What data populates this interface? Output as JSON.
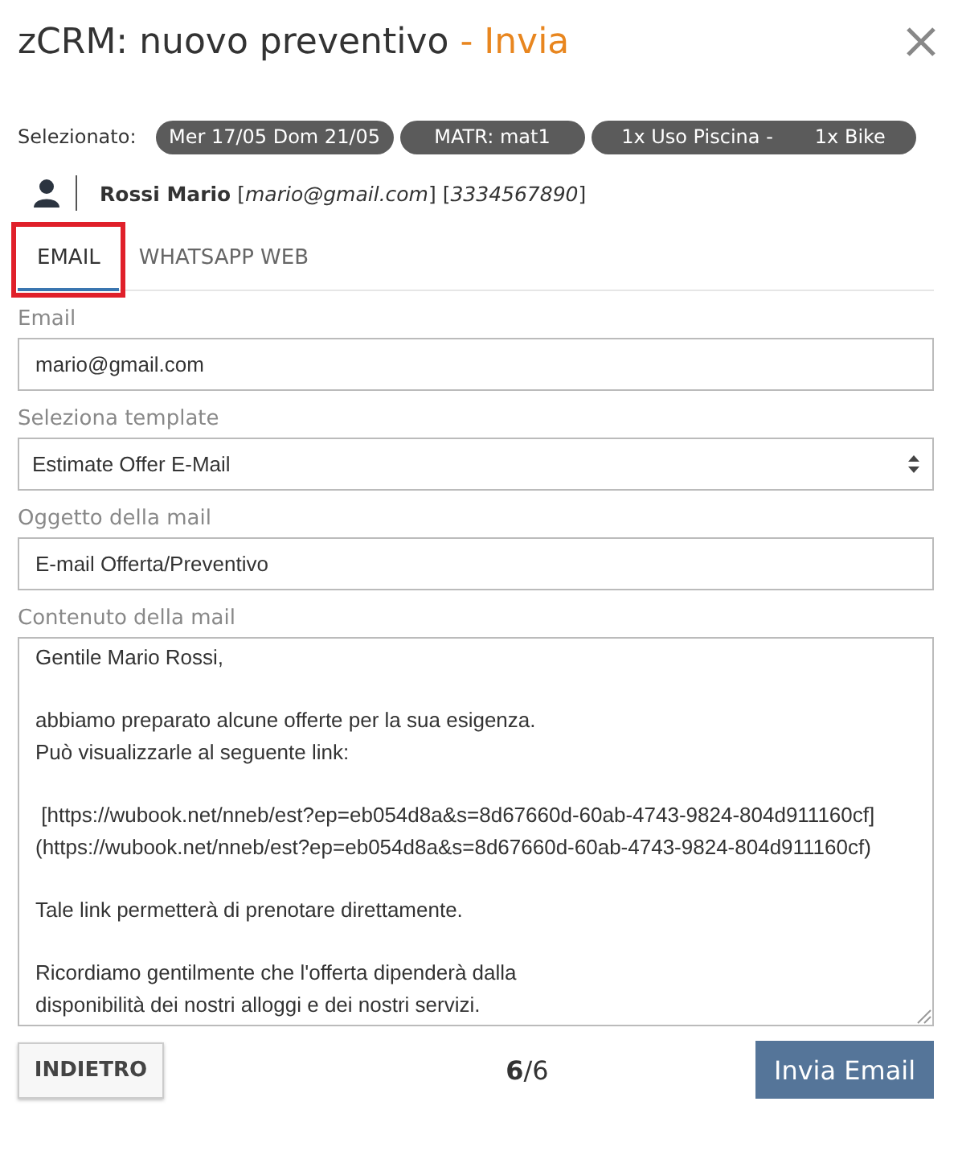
{
  "header": {
    "title": "zCRM: nuovo preventivo",
    "step": "- Invia"
  },
  "selection": {
    "label": "Selezionato:",
    "tags": [
      {
        "parts": [
          "Mer 17/05 Dom 21/05"
        ]
      },
      {
        "parts": [
          "MATR: mat1"
        ]
      },
      {
        "parts": [
          "1x Uso Piscina -",
          "1x Bike"
        ]
      }
    ]
  },
  "customer": {
    "info": "**Rossi Mario** [*mario@gmail.com*] [*3334567890*]"
  },
  "tabs": [
    {
      "label": "EMAIL",
      "selected": true,
      "highlighted": true
    },
    {
      "label": "WHATSAPP WEB",
      "selected": false,
      "highlighted": false
    }
  ],
  "fields": [
    {
      "kind": "input",
      "label": "Email",
      "value": "mario@gmail.com"
    },
    {
      "kind": "select",
      "label": "Seleziona template",
      "value": "Estimate Offer E-Mail"
    },
    {
      "kind": "input",
      "label": "Oggetto della mail",
      "value": "E-mail Offerta/Preventivo"
    },
    {
      "kind": "textarea",
      "label": "Contenuto della mail",
      "value": "Gentile Mario Rossi,\n\nabbiamo preparato alcune offerte per la sua esigenza.\nPuò visualizzarle al seguente link:\n\n [https://wubook.net/nneb/est?ep=eb054d8a&s=8d67660d-60ab-4743-9824-804d911160cf]\n(https://wubook.net/nneb/est?ep=eb054d8a&s=8d67660d-60ab-4743-9824-804d911160cf)\n\nTale link permetterà di prenotare direttamente.\n\nRicordiamo gentilmente che l'offerta dipenderà dalla\ndisponibilità dei nostri alloggi e dei nostri servizi."
    }
  ],
  "footer": {
    "back": "INDIETRO",
    "page": "6",
    "total": "/6",
    "send": "Invia Email"
  }
}
